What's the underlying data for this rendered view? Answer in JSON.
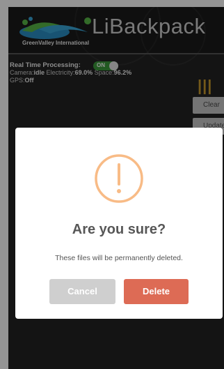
{
  "header": {
    "app_name": "LiBackpack",
    "company": "GreenValley International"
  },
  "status": {
    "rtp_label": "Real Time Processing:",
    "toggle_label": "ON",
    "camera_label": "Camera:",
    "camera_value": "idle",
    "electricity_label": "Electricity:",
    "electricity_value": "69.0%",
    "space_label": "Space:",
    "space_value": "96.2%",
    "gps_label": "GPS:",
    "gps_value": "Off"
  },
  "side_buttons": {
    "clear": "Clear",
    "update": "Update"
  },
  "dialog": {
    "icon": "exclamation-circle-icon",
    "title": "Are you sure?",
    "text": "These files will be permanently deleted.",
    "cancel_label": "Cancel",
    "delete_label": "Delete"
  },
  "colors": {
    "toggle_on": "#3c9a3c",
    "warning": "#f8bb86",
    "delete_button": "#dd6b55",
    "cancel_button": "#cfcfcf",
    "menu_icon": "#c89a2e"
  }
}
